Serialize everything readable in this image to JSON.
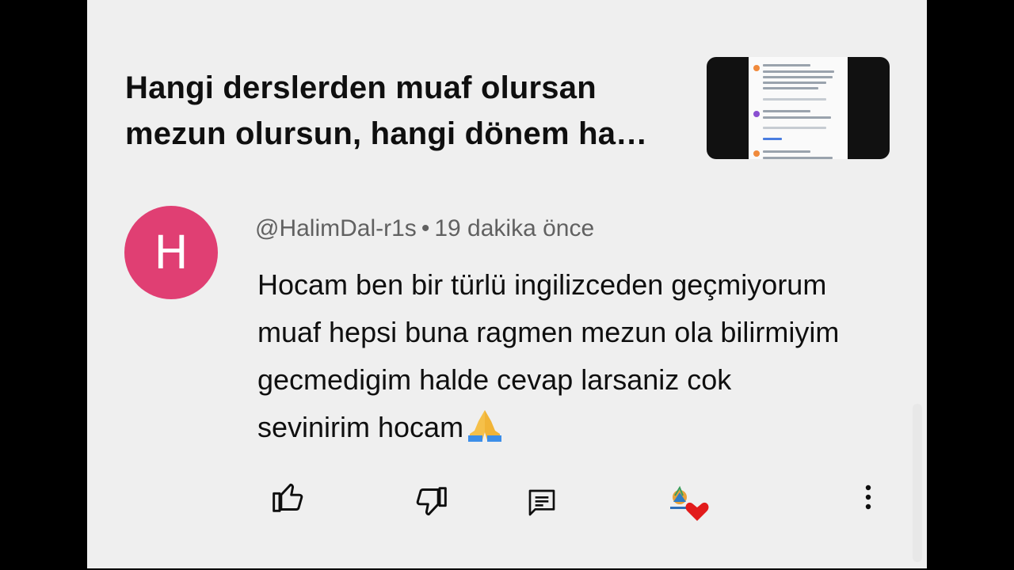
{
  "video": {
    "title": "Hangi derslerden muaf olursan mezun olursun, hangi dönem ha…"
  },
  "comment": {
    "avatar_letter": "H",
    "avatar_color": "#e03f73",
    "author": "@HalimDal-r1s",
    "separator": "•",
    "time": "19 dakika önce",
    "text": "Hocam ben bir türlü ingilizceden geçmiyorum muaf hepsi buna ragmen mezun ola bilirmiyim gecmedigim halde cevap larsaniz cok sevinirim hocam",
    "emoji": "🙏"
  },
  "actions": {
    "icons": [
      "thumbs-up-icon",
      "thumbs-down-icon",
      "reply-icon",
      "creator-heart-icon",
      "more-vert-icon"
    ]
  }
}
